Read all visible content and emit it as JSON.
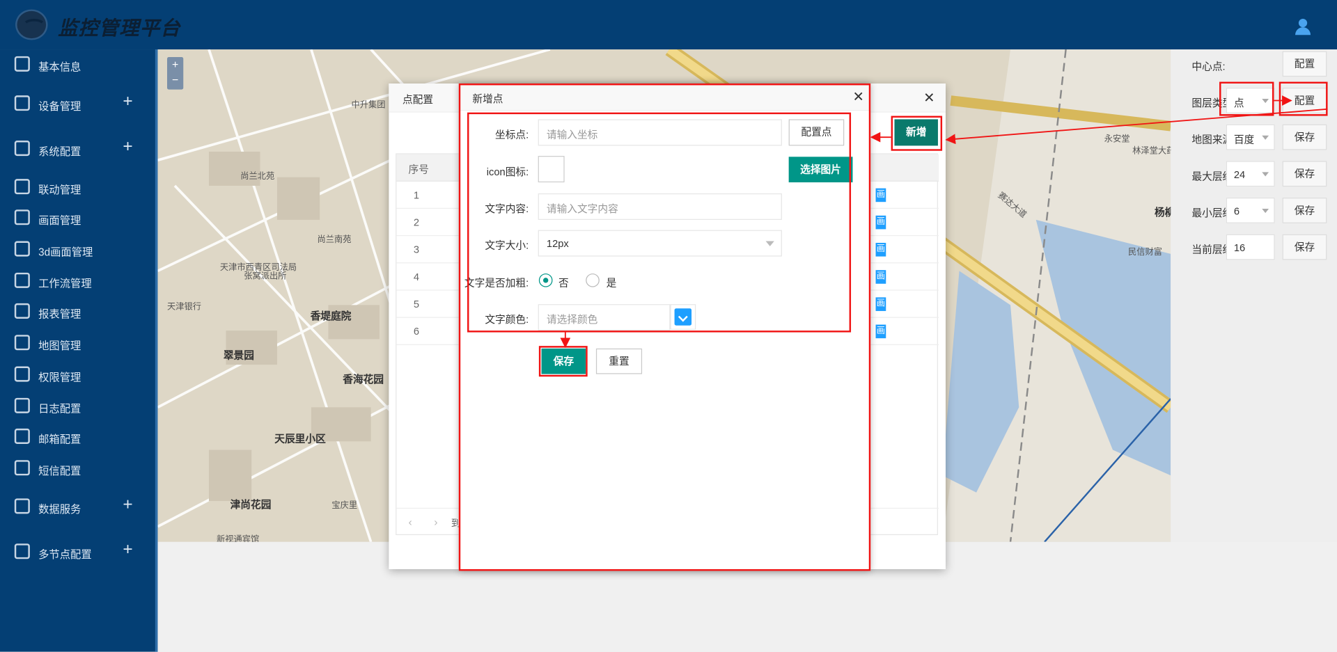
{
  "app": {
    "title": "监控管理平台"
  },
  "sidebar": {
    "items": [
      {
        "label": "基本信息"
      },
      {
        "label": "设备管理",
        "expand": "+"
      },
      {
        "label": "系统配置",
        "expand": "+"
      },
      {
        "label": "联动管理"
      },
      {
        "label": "画面管理"
      },
      {
        "label": "3d画面管理"
      },
      {
        "label": "工作流管理"
      },
      {
        "label": "报表管理"
      },
      {
        "label": "地图管理"
      },
      {
        "label": "权限管理"
      },
      {
        "label": "日志配置"
      },
      {
        "label": "邮箱配置"
      },
      {
        "label": "短信配置"
      },
      {
        "label": "数据服务",
        "expand": "+"
      },
      {
        "label": "多节点配置",
        "expand": "+"
      }
    ]
  },
  "map": {
    "zoom_in": "+",
    "zoom_out": "−",
    "labels": [
      "中升集团",
      "尚兰北苑",
      "尚兰南苑",
      "天津市西青区司法局",
      "张窝派出所",
      "天津银行",
      "香堤庭院",
      "翠景园",
      "香海花园",
      "天辰里小区",
      "津尚花园",
      "宝庆里",
      "新视通宾馆",
      "永安堂",
      "林泽堂大药房",
      "民信财富",
      "杨柳青水库",
      "赛达大道"
    ]
  },
  "right_panel": {
    "rows": [
      {
        "label": "中心点:",
        "value": "",
        "button": "配置"
      },
      {
        "label": "图层类型:",
        "value": "点",
        "button": "配置"
      },
      {
        "label": "地图来源:",
        "value": "百度",
        "button": "保存"
      },
      {
        "label": "最大层级:",
        "value": "24",
        "button": "保存"
      },
      {
        "label": "最小层级:",
        "value": "6",
        "button": "保存"
      },
      {
        "label": "当前层级:",
        "value": "16",
        "button": "保存"
      }
    ],
    "add_button": "新增"
  },
  "outer_dialog": {
    "title": "点配置",
    "close": "✕",
    "table": {
      "header": "序号",
      "rows": [
        "1",
        "2",
        "3",
        "4",
        "5",
        "6"
      ],
      "op_label": "画"
    },
    "pager": {
      "prev": "‹",
      "next": "›",
      "goto": "到"
    }
  },
  "inner_dialog": {
    "title": "新增点",
    "close": "✕",
    "coord": {
      "label": "坐标点:",
      "placeholder": "请输入坐标",
      "button": "配置点"
    },
    "icon": {
      "label": "icon图标:",
      "button": "选择图片"
    },
    "text": {
      "label": "文字内容:",
      "placeholder": "请输入文字内容"
    },
    "size": {
      "label": "文字大小:",
      "value": "12px"
    },
    "bold": {
      "label": "文字是否加粗:",
      "options": [
        "否",
        "是"
      ],
      "selected": "否"
    },
    "color": {
      "label": "文字颜色:",
      "placeholder": "请选择颜色"
    },
    "save": "保存",
    "reset": "重置"
  },
  "colors": {
    "header": "#043f74",
    "primary": "#009688",
    "annotation": "#f01414",
    "accent": "#1e9fff"
  }
}
